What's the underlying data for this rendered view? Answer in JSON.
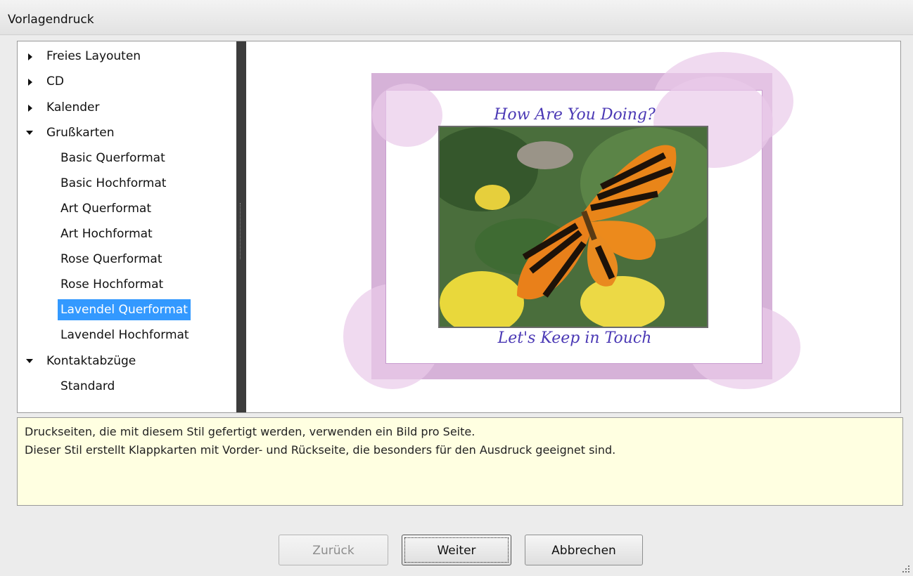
{
  "window": {
    "title": "Vorlagendruck"
  },
  "tree": {
    "items": [
      {
        "label": "Freies Layouten",
        "level": 0,
        "expanded": false
      },
      {
        "label": "CD",
        "level": 0,
        "expanded": false
      },
      {
        "label": "Kalender",
        "level": 0,
        "expanded": false
      },
      {
        "label": "Grußkarten",
        "level": 0,
        "expanded": true
      },
      {
        "label": "Basic Querformat",
        "level": 1
      },
      {
        "label": "Basic Hochformat",
        "level": 1
      },
      {
        "label": "Art Querformat",
        "level": 1
      },
      {
        "label": "Art Hochformat",
        "level": 1
      },
      {
        "label": "Rose Querformat",
        "level": 1
      },
      {
        "label": "Rose Hochformat",
        "level": 1
      },
      {
        "label": "Lavendel Querformat",
        "level": 1,
        "selected": true
      },
      {
        "label": "Lavendel Hochformat",
        "level": 1
      },
      {
        "label": "Kontaktabzüge",
        "level": 0,
        "expanded": true
      },
      {
        "label": "Standard",
        "level": 1
      }
    ]
  },
  "preview": {
    "top_text": "How Are You Doing?",
    "bottom_text": "Let's Keep in Touch",
    "photo": "butterfly-on-yellow-flowers"
  },
  "description": {
    "line1": "Druckseiten, die mit diesem Stil gefertigt werden, verwenden ein Bild pro Seite.",
    "line2": "Dieser Stil erstellt Klappkarten mit Vorder- und Rückseite, die besonders für den Ausdruck geeignet sind."
  },
  "buttons": {
    "back_label": "Zurück",
    "next_label": "Weiter",
    "cancel_label": "Abbrechen"
  },
  "colors": {
    "selection": "#3399ff",
    "description_bg": "#ffffe1",
    "card_frame": "#d6b2d8",
    "card_text": "#4b39b5"
  }
}
